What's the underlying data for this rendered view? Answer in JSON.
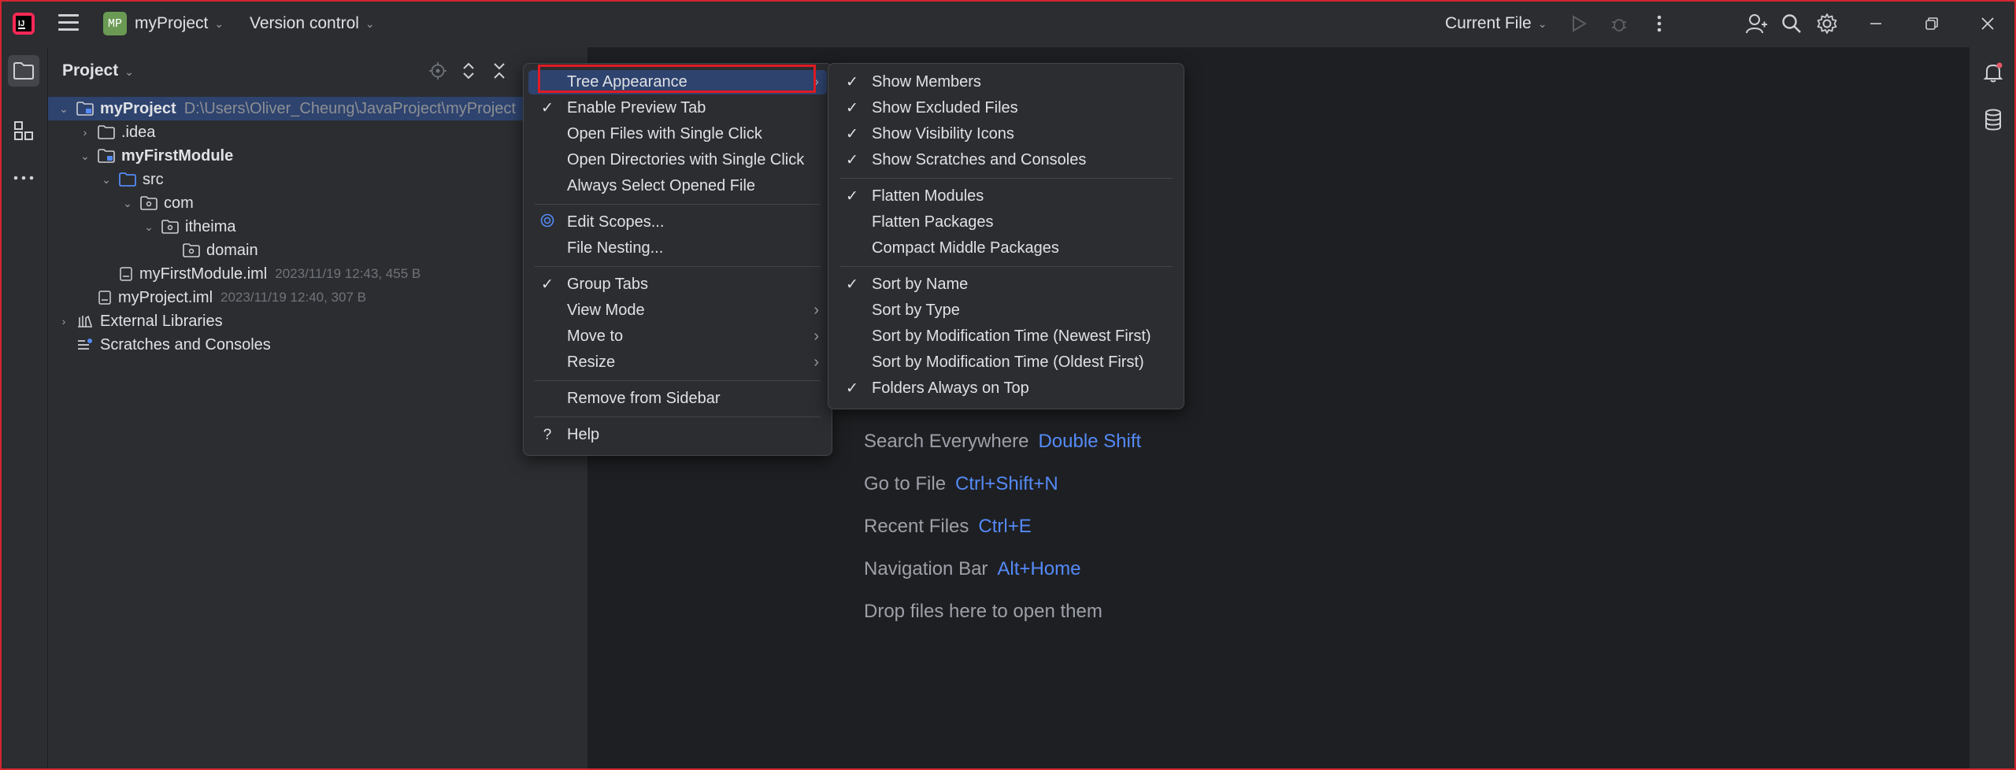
{
  "titlebar": {
    "project_badge": "MP",
    "project_name": "myProject",
    "vcs": "Version control",
    "run_config": "Current File"
  },
  "project_panel": {
    "title": "Project",
    "tree": [
      {
        "label": "myProject",
        "path": "D:\\Users\\Oliver_Cheung\\JavaProject\\myProject",
        "selected": true
      },
      {
        "label": ".idea"
      },
      {
        "label": "myFirstModule"
      },
      {
        "label": "src"
      },
      {
        "label": "com"
      },
      {
        "label": "itheima"
      },
      {
        "label": "domain"
      },
      {
        "label": "myFirstModule.iml",
        "meta": "2023/11/19 12:43, 455 B"
      },
      {
        "label": "myProject.iml",
        "meta": "2023/11/19 12:40, 307 B"
      },
      {
        "label": "External Libraries"
      },
      {
        "label": "Scratches and Consoles"
      }
    ]
  },
  "editor_hints": [
    {
      "label": "Search Everywhere",
      "key": "Double Shift"
    },
    {
      "label": "Go to File",
      "key": "Ctrl+Shift+N"
    },
    {
      "label": "Recent Files",
      "key": "Ctrl+E"
    },
    {
      "label": "Navigation Bar",
      "key": "Alt+Home"
    },
    {
      "label": "Drop files here to open them",
      "key": ""
    }
  ],
  "context_menu": {
    "items": [
      {
        "label": "Tree Appearance",
        "submenu": true,
        "highlighted": true
      },
      {
        "label": "Enable Preview Tab",
        "checked": true
      },
      {
        "label": "Open Files with Single Click"
      },
      {
        "label": "Open Directories with Single Click"
      },
      {
        "label": "Always Select Opened File"
      },
      {
        "label": "Edit Scopes..."
      },
      {
        "label": "File Nesting..."
      },
      {
        "label": "Group Tabs",
        "checked": true
      },
      {
        "label": "View Mode",
        "submenu": true
      },
      {
        "label": "Move to",
        "submenu": true
      },
      {
        "label": "Resize",
        "submenu": true
      },
      {
        "label": "Remove from Sidebar"
      },
      {
        "label": "Help"
      }
    ]
  },
  "submenu": {
    "items": [
      {
        "label": "Show Members",
        "checked": true
      },
      {
        "label": "Show Excluded Files",
        "checked": true
      },
      {
        "label": "Show Visibility Icons",
        "checked": true
      },
      {
        "label": "Show Scratches and Consoles",
        "checked": true
      },
      {
        "label": "Flatten Modules",
        "checked": true
      },
      {
        "label": "Flatten Packages"
      },
      {
        "label": "Compact Middle Packages"
      },
      {
        "label": "Sort by Name",
        "checked": true
      },
      {
        "label": "Sort by Type"
      },
      {
        "label": "Sort by Modification Time (Newest First)"
      },
      {
        "label": "Sort by Modification Time (Oldest First)"
      },
      {
        "label": "Folders Always on Top",
        "checked": true
      }
    ]
  },
  "colors": {
    "accent": "#548af7",
    "selection": "#2e436e",
    "annotation": "#e01b24"
  }
}
